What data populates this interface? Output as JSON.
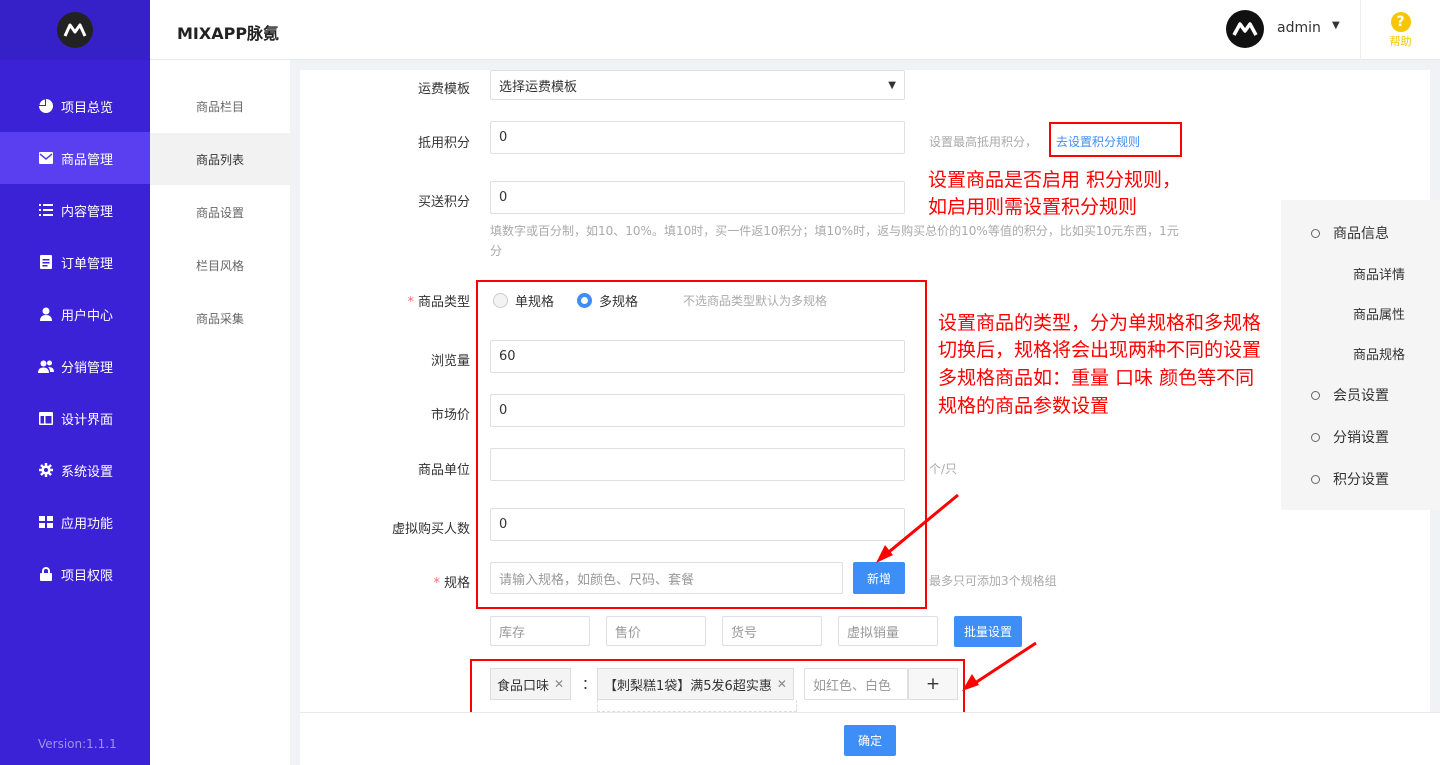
{
  "app": {
    "title": "MIXAPP脉氪",
    "user": "admin",
    "help": "帮助",
    "version": "Version:1.1.1"
  },
  "sidebar": {
    "items": [
      {
        "label": "项目总览",
        "icon": "pie-chart-icon"
      },
      {
        "label": "商品管理",
        "icon": "mail-icon"
      },
      {
        "label": "内容管理",
        "icon": "list-icon"
      },
      {
        "label": "订单管理",
        "icon": "document-icon"
      },
      {
        "label": "用户中心",
        "icon": "user-icon"
      },
      {
        "label": "分销管理",
        "icon": "users-icon"
      },
      {
        "label": "设计界面",
        "icon": "layout-icon"
      },
      {
        "label": "系统设置",
        "icon": "gear-icon"
      },
      {
        "label": "应用功能",
        "icon": "grid-icon"
      },
      {
        "label": "项目权限",
        "icon": "lock-icon"
      }
    ]
  },
  "submenu": {
    "items": [
      "商品栏目",
      "商品列表",
      "商品设置",
      "栏目风格",
      "商品采集"
    ]
  },
  "form": {
    "shipping_label": "运费模板",
    "shipping_value": "选择运费模板",
    "points_use_label": "抵用积分",
    "points_use_value": "0",
    "points_use_hint": "设置最高抵用积分，",
    "points_rule_link": "去设置积分规则",
    "points_give_label": "买送积分",
    "points_give_value": "0",
    "points_give_hint_1": "填数字或百分制，如10、10%。填10时，买一件返10积分；填10%时，返与购买总价的10%等值的积分，比如买10元东西，1元",
    "points_give_hint_2": "分",
    "type_label": "商品类型",
    "type_single": "单规格",
    "type_multi": "多规格",
    "type_hint": "不选商品类型默认为多规格",
    "views_label": "浏览量",
    "views_value": "60",
    "market_price_label": "市场价",
    "market_price_value": "0",
    "unit_label": "商品单位",
    "unit_value": "",
    "unit_hint": "个/只",
    "virtual_buyers_label": "虚拟购买人数",
    "virtual_buyers_value": "0",
    "spec_label": "规格",
    "spec_placeholder": "请输入规格，如颜色、尺码、套餐",
    "spec_add": "新增",
    "spec_hint": "最多只可添加3个规格组",
    "batch": {
      "stock": "库存",
      "price": "售价",
      "sku": "货号",
      "virtual_sales": "虚拟销量",
      "button": "批量设置"
    },
    "spec_group": {
      "name": "食品口味",
      "colon": "：",
      "value": "【刺梨糕1袋】满5发6超实惠",
      "value_placeholder": "如红色、白色",
      "add": "+"
    },
    "confirm": "确定"
  },
  "annotations": {
    "points": [
      "设置商品是否启用  积分规则，",
      "如启用则需设置积分规则"
    ],
    "type": [
      "设置商品的类型，分为单规格和多规格",
      "切换后，规格将会出现两种不同的设置",
      "多规格商品如：重量  口味  颜色等不同",
      "规格的商品参数设置"
    ]
  },
  "anchor_nav": {
    "product_info": "商品信息",
    "product_detail": "商品详情",
    "product_attr": "商品属性",
    "product_spec": "商品规格",
    "member": "会员设置",
    "distribution": "分销设置",
    "points": "积分设置"
  },
  "colors": {
    "sidebar": "#3b22d6",
    "sidebar_active": "#5a3ff0",
    "primary": "#3e8ef7",
    "annotation": "#ff0000",
    "help": "#f7c600"
  }
}
